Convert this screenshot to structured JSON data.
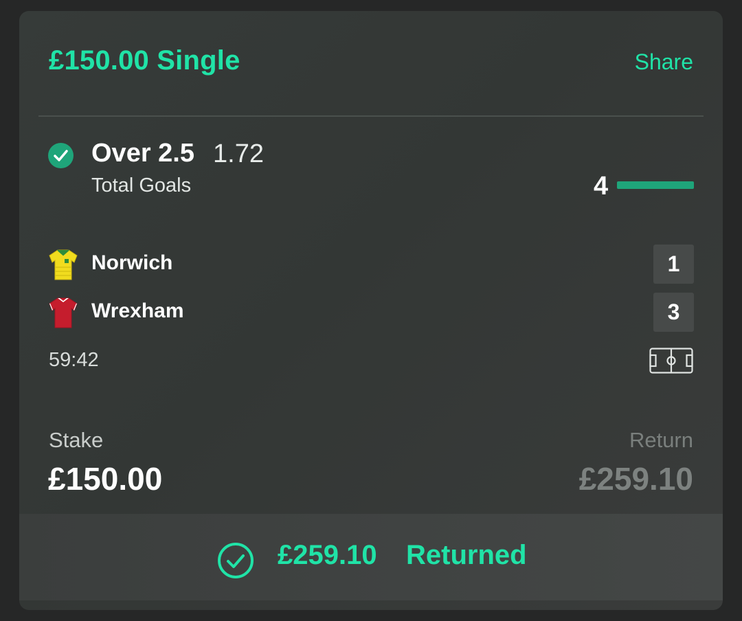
{
  "bet": {
    "title": "£150.00 Single",
    "share_label": "Share"
  },
  "selection": {
    "name": "Over 2.5",
    "odds": "1.72",
    "market": "Total Goals",
    "total_goals": "4",
    "status_icon": "check-circle-icon"
  },
  "match": {
    "teams": [
      {
        "name": "Norwich",
        "score": "1",
        "kit_colors": [
          "#f1dc1e",
          "#2f8d3a"
        ]
      },
      {
        "name": "Wrexham",
        "score": "3",
        "kit_colors": [
          "#c51d2d",
          "#ffffff"
        ]
      }
    ],
    "clock": "59:42",
    "pitch_icon": "pitch-icon"
  },
  "summary": {
    "stake_label": "Stake",
    "stake_value": "£150.00",
    "return_label": "Return",
    "return_value": "£259.10"
  },
  "result": {
    "amount": "£259.10",
    "status": "Returned",
    "icon": "check-circle-outline-icon"
  },
  "colors": {
    "accent": "#20e3a7",
    "success": "#1fa57a"
  }
}
